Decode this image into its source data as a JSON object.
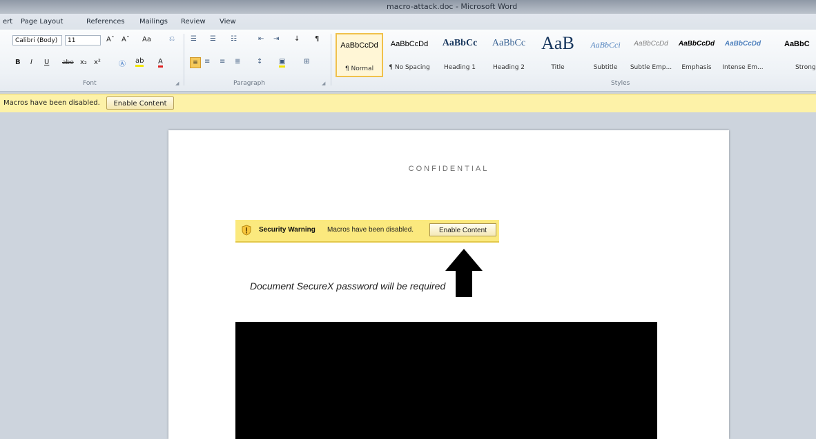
{
  "window": {
    "title": "macro-attack.doc - Microsoft Word"
  },
  "tabs": [
    "ert",
    "Page Layout",
    "References",
    "Mailings",
    "Review",
    "View"
  ],
  "ribbon": {
    "font_name": "Calibri (Body)",
    "font_size": "11",
    "grow_font": "Aˆ",
    "shrink_font": "Aˇ",
    "change_case": "Aa",
    "bold": "B",
    "italic": "I",
    "underline": "U",
    "strikethrough": "abe",
    "subscript": "x₂",
    "superscript": "x²",
    "font_color": "A",
    "sort": "↓",
    "pilcrow": "¶",
    "groups": {
      "font": "Font",
      "paragraph": "Paragraph",
      "styles": "Styles"
    },
    "styles": [
      {
        "sample": "AaBbCcDd",
        "name": "¶ Normal",
        "selected": true
      },
      {
        "sample": "AaBbCcDd",
        "name": "¶ No Spacing"
      },
      {
        "sample": "AaBbCc",
        "name": "Heading 1"
      },
      {
        "sample": "AaBbCc",
        "name": "Heading 2"
      },
      {
        "sample": "AaB",
        "name": "Title"
      },
      {
        "sample": "AaBbCci",
        "name": "Subtitle"
      },
      {
        "sample": "AaBbCcDd",
        "name": "Subtle Emp..."
      },
      {
        "sample": "AaBbCcDd",
        "name": "Emphasis"
      },
      {
        "sample": "AaBbCcDd",
        "name": "Intense Em..."
      },
      {
        "sample": "AaBbC",
        "name": "Strong"
      }
    ]
  },
  "message_bar": {
    "text": "Macros have been disabled.",
    "button": "Enable Content",
    "bg_color": "#fdf2a8"
  },
  "document": {
    "header": "CONFIDENTIAL",
    "security_warning": {
      "label": "Security Warning",
      "message": "Macros have been disabled.",
      "button": "Enable Content",
      "icon": "warning-shield-icon"
    },
    "pointer_icon": "arrow-up-icon",
    "instruction": "Document SecureX password will be required"
  }
}
